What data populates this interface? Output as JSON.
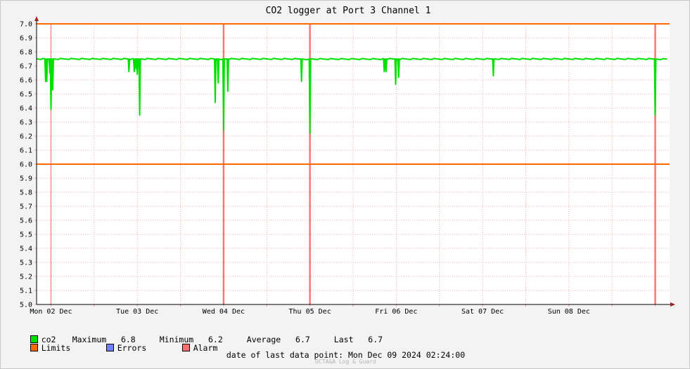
{
  "chart_data": {
    "type": "line",
    "title": "CO2 logger at Port 3 Channel 1",
    "ylim": [
      5.0,
      7.0
    ],
    "y_ticks": [
      "5.0",
      "5.1",
      "5.2",
      "5.3",
      "5.4",
      "5.5",
      "5.6",
      "5.7",
      "5.8",
      "5.9",
      "6.0",
      "6.1",
      "6.2",
      "6.3",
      "6.4",
      "6.5",
      "6.6",
      "6.7",
      "6.8",
      "6.9",
      "7.0"
    ],
    "x_start": "Dec 01 2024 20:00",
    "x_end": "Dec 09 2024 04:00",
    "x_ticks": [
      {
        "label": "Mon 02 Dec",
        "t": "Dec 02 2024 00:00"
      },
      {
        "label": "Tue 03 Dec",
        "t": "Dec 03 2024 00:00"
      },
      {
        "label": "Wed 04 Dec",
        "t": "Dec 04 2024 00:00"
      },
      {
        "label": "Thu 05 Dec",
        "t": "Dec 05 2024 00:00"
      },
      {
        "label": "Fri 06 Dec",
        "t": "Dec 06 2024 00:00"
      },
      {
        "label": "Sat 07 Dec",
        "t": "Dec 07 2024 00:00"
      },
      {
        "label": "Sun 08 Dec",
        "t": "Dec 08 2024 00:00"
      }
    ],
    "grid": true,
    "limits": [
      6.0,
      7.0
    ],
    "alarms": [
      "Dec 02 2024 00:00",
      "Dec 04 2024 00:00",
      "Dec 05 2024 00:00",
      "Dec 09 2024 00:00"
    ],
    "series": [
      {
        "name": "co2",
        "baseline": 6.75,
        "dips": [
          {
            "t": "Dec 01 2024 22:30",
            "min": 6.59
          },
          {
            "t": "Dec 01 2024 22:50",
            "min": 6.59
          },
          {
            "t": "Dec 01 2024 23:40",
            "min": 6.65
          },
          {
            "t": "Dec 02 2024 00:00",
            "min": 6.39
          },
          {
            "t": "Dec 02 2024 00:30",
            "min": 6.53
          },
          {
            "t": "Dec 02 2024 21:40",
            "min": 6.66
          },
          {
            "t": "Dec 02 2024 23:10",
            "min": 6.66
          },
          {
            "t": "Dec 02 2024 23:40",
            "min": 6.68
          },
          {
            "t": "Dec 03 2024 00:00",
            "min": 6.64
          },
          {
            "t": "Dec 03 2024 00:40",
            "min": 6.35
          },
          {
            "t": "Dec 03 2024 21:40",
            "min": 6.44
          },
          {
            "t": "Dec 03 2024 22:30",
            "min": 6.58
          },
          {
            "t": "Dec 04 2024 00:00",
            "min": 6.24
          },
          {
            "t": "Dec 04 2024 01:10",
            "min": 6.52
          },
          {
            "t": "Dec 04 2024 21:40",
            "min": 6.59
          },
          {
            "t": "Dec 05 2024 00:00",
            "min": 6.22
          },
          {
            "t": "Dec 05 2024 20:40",
            "min": 6.66
          },
          {
            "t": "Dec 05 2024 21:10",
            "min": 6.66
          },
          {
            "t": "Dec 05 2024 23:50",
            "min": 6.57
          },
          {
            "t": "Dec 06 2024 00:40",
            "min": 6.62
          },
          {
            "t": "Dec 07 2024 03:00",
            "min": 6.63
          },
          {
            "t": "Dec 09 2024 00:00",
            "min": 6.35
          }
        ]
      }
    ]
  },
  "legend": {
    "co2": {
      "label": "co2",
      "color": "#00e000"
    },
    "limits": {
      "label": "Limits",
      "color": "#ff6a00"
    },
    "errors": {
      "label": "Errors",
      "color": "#7080ff"
    },
    "alarm": {
      "label": "Alarm",
      "color": "#ff7070"
    }
  },
  "stats": {
    "maximum_label": "Maximum",
    "maximum": "6.8",
    "minimum_label": "Minimum",
    "minimum": "6.2",
    "average_label": "Average",
    "average": "6.7",
    "last_label": "Last",
    "last": "6.7"
  },
  "footer": {
    "last_data_point": "date of last data point:  Mon Dec 09 2024 02:24:00",
    "credit": "OCTA&A Log & Guard"
  }
}
